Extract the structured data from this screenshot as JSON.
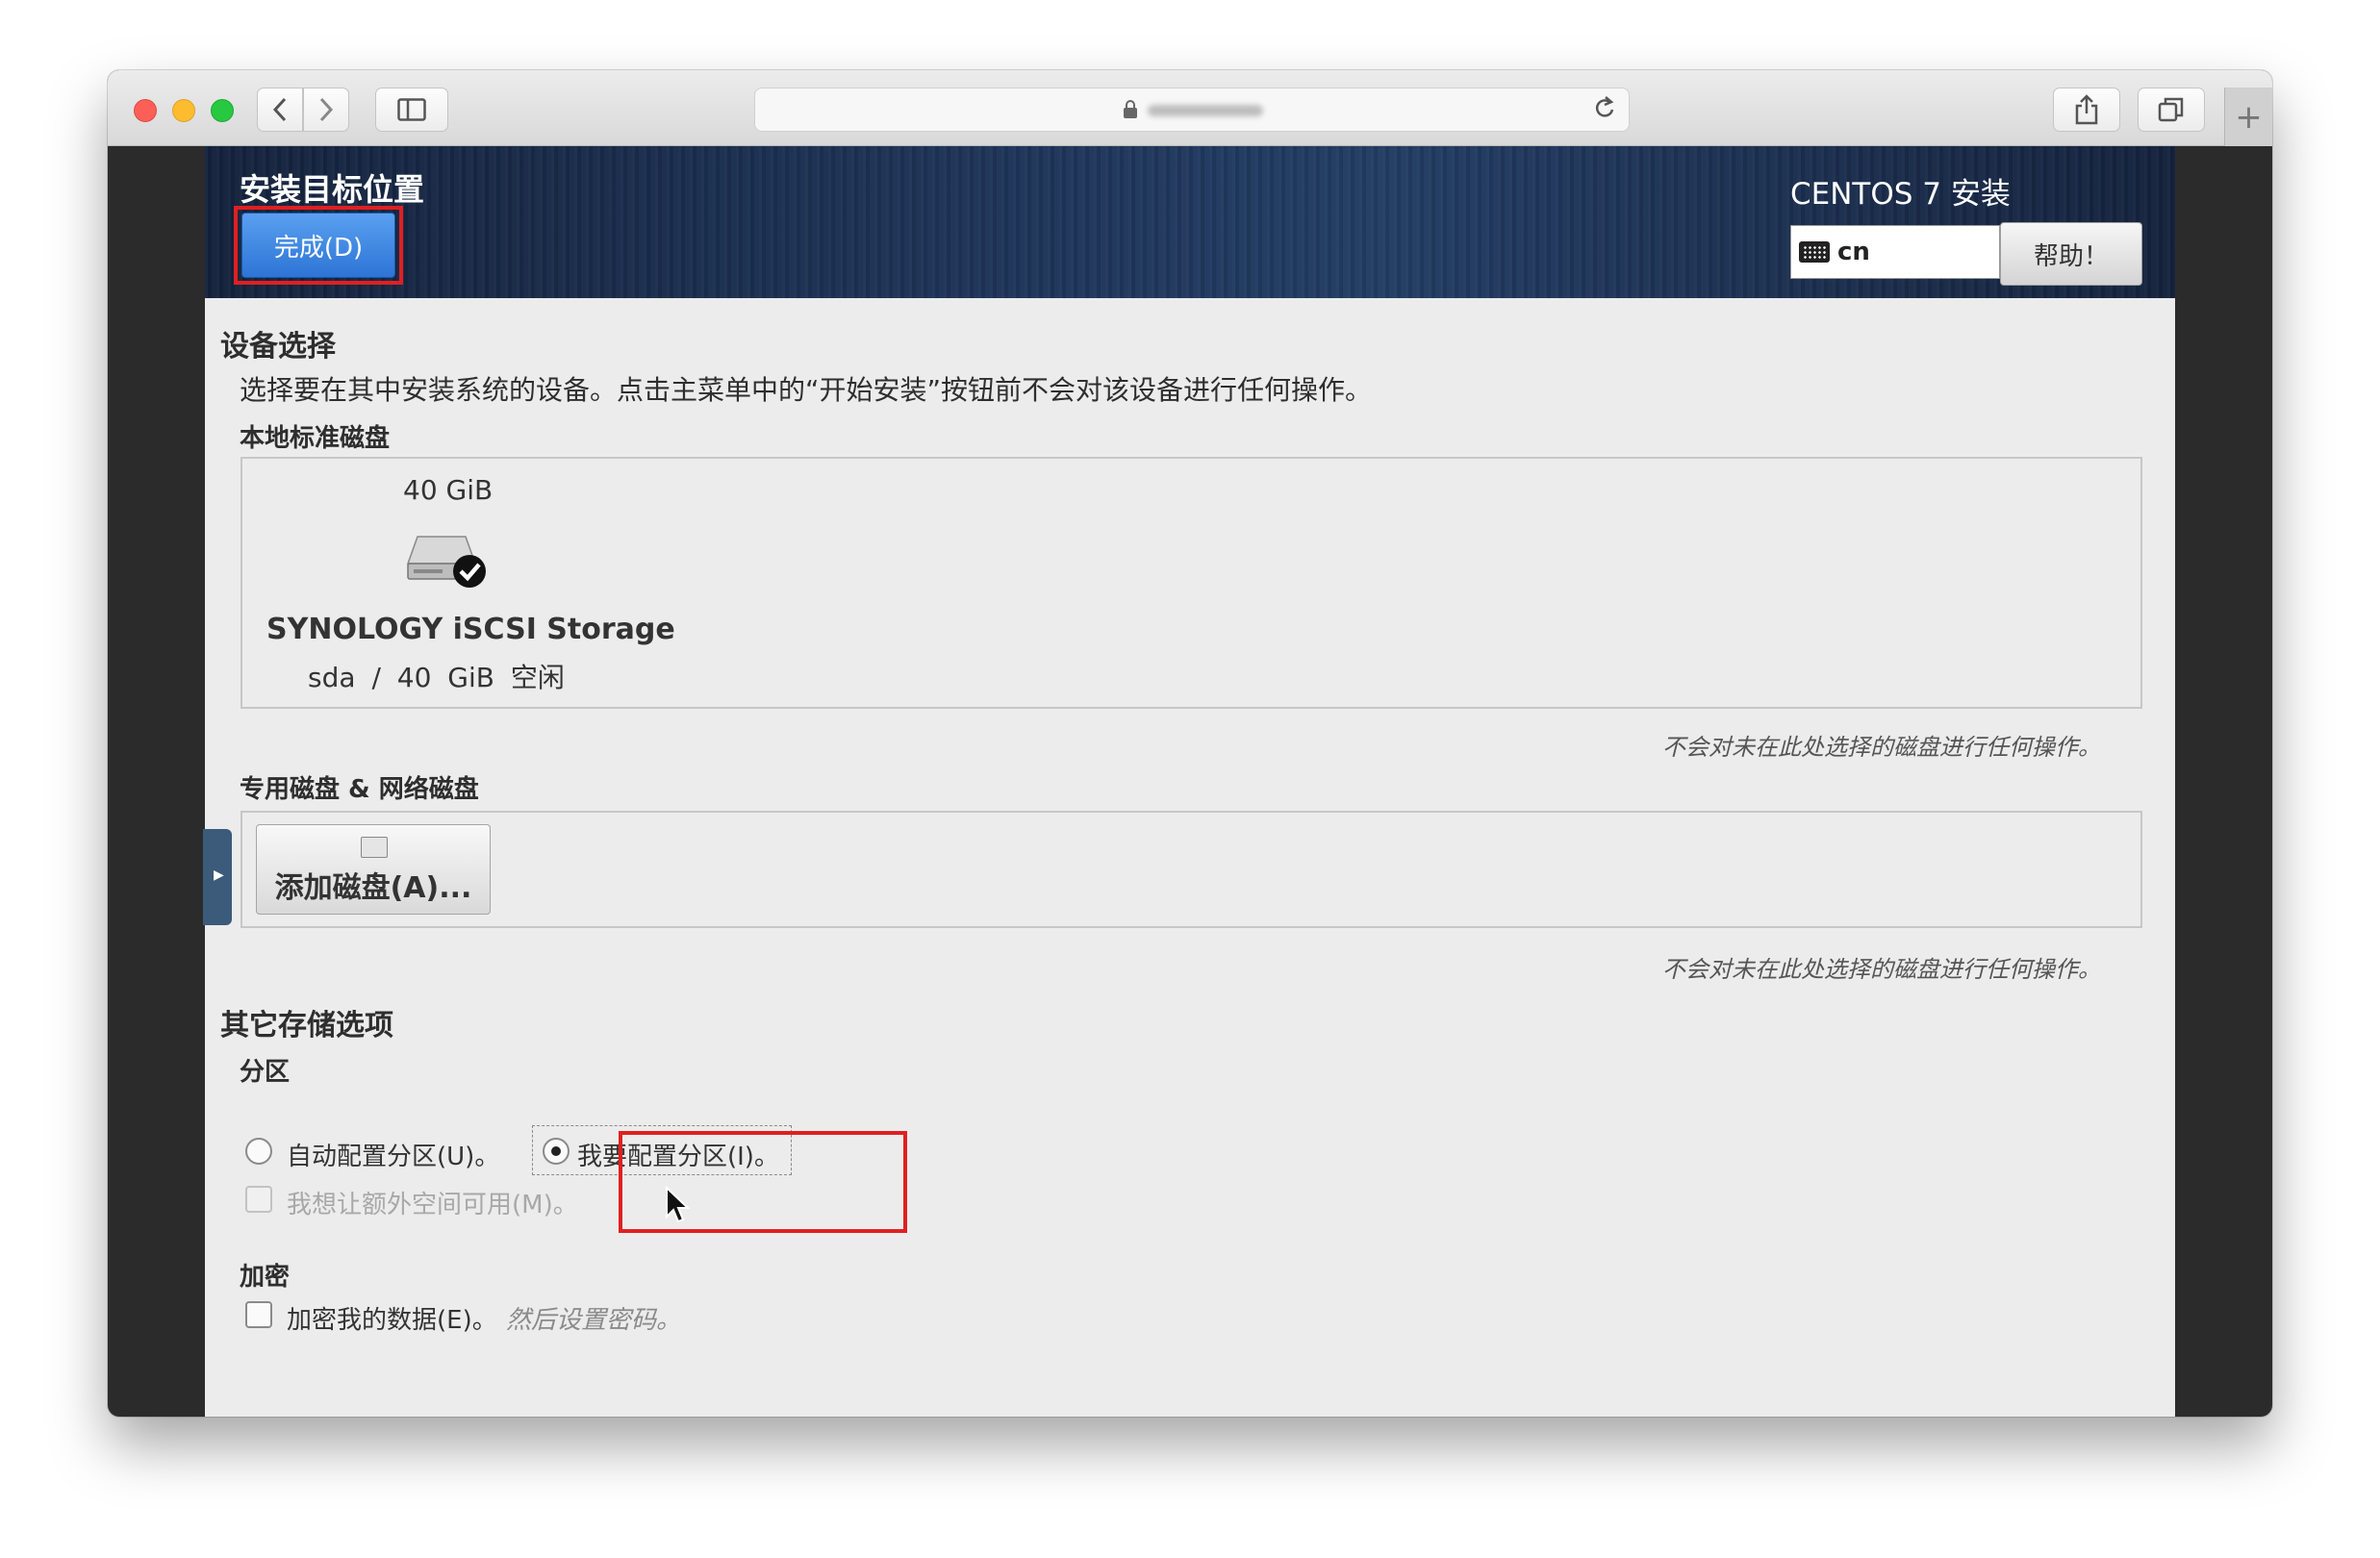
{
  "browser": {
    "back_icon": "chevron-left-icon",
    "forward_icon": "chevron-right-icon",
    "sidebar_icon": "sidebar-icon",
    "lock_icon": "lock-icon",
    "reload_icon": "reload-icon",
    "share_icon": "share-icon",
    "tabs_icon": "tabs-icon",
    "new_tab_label": "+"
  },
  "header": {
    "title": "安装目标位置",
    "done_button": "完成(D)",
    "product": "CENTOS 7 安装",
    "keyboard_layout": "cn",
    "help_button": "帮助！"
  },
  "device_selection": {
    "title": "设备选择",
    "description": "选择要在其中安装系统的设备。点击主菜单中的“开始安装”按钮前不会对该设备进行任何操作。",
    "local_disks_title": "本地标准磁盘",
    "disk": {
      "size": "40 GiB",
      "name": "SYNOLOGY iSCSI Storage",
      "device": "sda",
      "separator": "/",
      "free": "40 GiB 空闲"
    },
    "local_note": "不会对未在此处选择的磁盘进行任何操作。",
    "special_disks_title": "专用磁盘 & 网络磁盘",
    "add_disk_button": "添加磁盘(A)...",
    "special_note": "不会对未在此处选择的磁盘进行任何操作。"
  },
  "other_storage": {
    "title": "其它存储选项",
    "partitioning_title": "分区",
    "auto_partition": "自动配置分区(U)。",
    "manual_partition": "我要配置分区(I)。",
    "selected_option": "manual",
    "extra_space": "我想让额外空间可用(M)。",
    "encryption_title": "加密",
    "encrypt_data": "加密我的数据(E)。",
    "encrypt_hint": "然后设置密码。"
  },
  "colors": {
    "accent_blue": "#2d74d6",
    "highlight_red": "#e02020",
    "header_bg": "#1d3458"
  }
}
